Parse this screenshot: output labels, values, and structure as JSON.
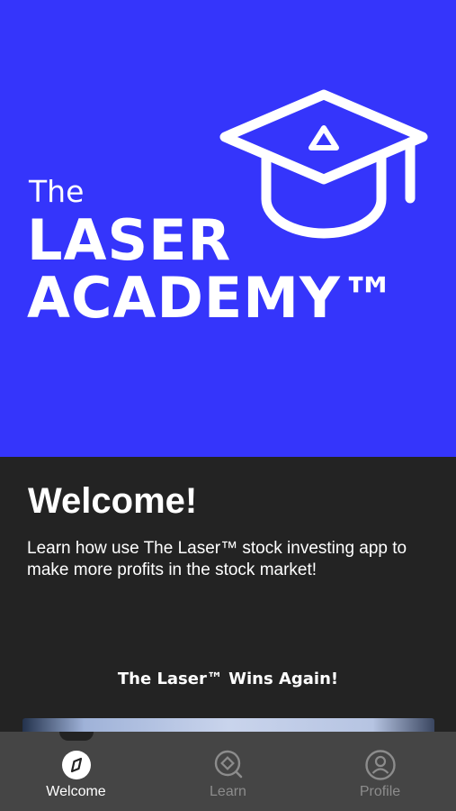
{
  "logo": {
    "line1": "The",
    "line2": "LASER",
    "line3": "ACADEMY™",
    "brand_color": "#3535fb",
    "icon": "graduation-cap-icon"
  },
  "welcome": {
    "title": "Welcome!",
    "description": "Learn how use The Laser™ stock investing app to make more profits in the stock market!"
  },
  "video": {
    "title": "The Laser™ Wins Again!"
  },
  "tabbar": {
    "active_color": "#ffffff",
    "inactive_color": "#8c8c8c",
    "items": [
      {
        "label": "Welcome",
        "icon": "compass-icon",
        "active": true
      },
      {
        "label": "Learn",
        "icon": "search-icon",
        "active": false
      },
      {
        "label": "Profile",
        "icon": "profile-icon",
        "active": false
      }
    ]
  }
}
